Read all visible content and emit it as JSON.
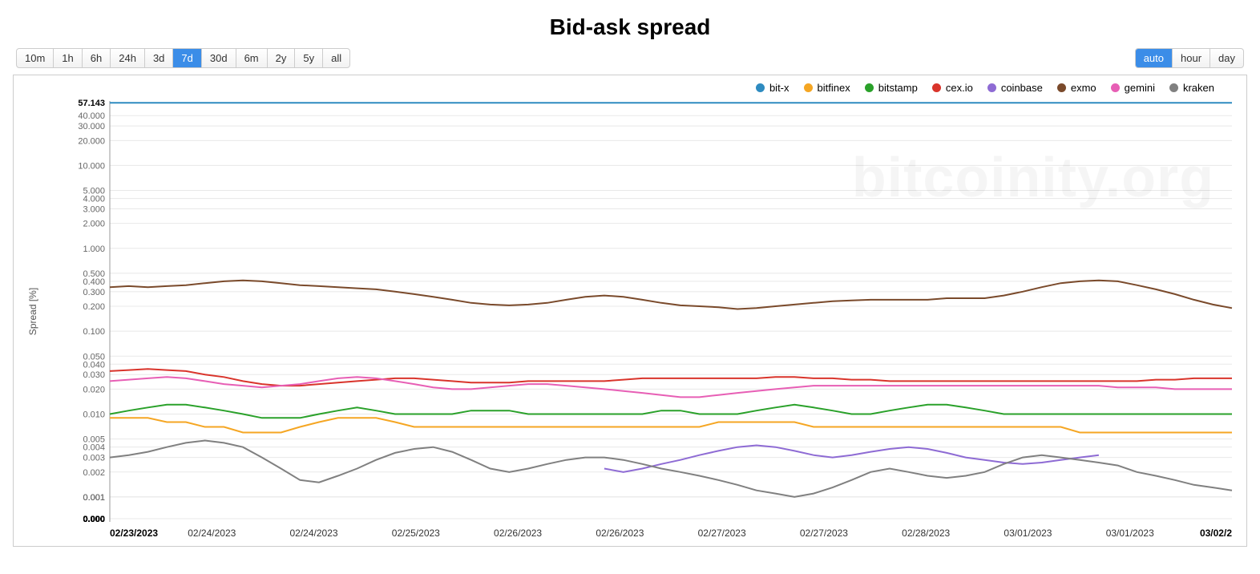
{
  "title": "Bid-ask spread",
  "watermark": "bitcoinity.org",
  "range_buttons": [
    "10m",
    "1h",
    "6h",
    "24h",
    "3d",
    "7d",
    "30d",
    "6m",
    "2y",
    "5y",
    "all"
  ],
  "range_active": "7d",
  "agg_buttons": [
    "auto",
    "hour",
    "day"
  ],
  "agg_active": "auto",
  "ylabel": "Spread [%]",
  "legend": [
    {
      "name": "bit-x",
      "color": "#2e8bc0"
    },
    {
      "name": "bitfinex",
      "color": "#f5a623"
    },
    {
      "name": "bitstamp",
      "color": "#2aa12a"
    },
    {
      "name": "cex.io",
      "color": "#d9342b"
    },
    {
      "name": "coinbase",
      "color": "#8e6bd4"
    },
    {
      "name": "exmo",
      "color": "#7a4a2b"
    },
    {
      "name": "gemini",
      "color": "#e75fb5"
    },
    {
      "name": "kraken",
      "color": "#808080"
    }
  ],
  "chart_data": {
    "type": "line",
    "title": "Bid-ask spread",
    "xlabel": "",
    "ylabel": "Spread [%]",
    "yscale": "log",
    "ylim": [
      0.0,
      57.143
    ],
    "yticks_top": 57.143,
    "yticks_bottom": 0.0,
    "yticks": [
      57.143,
      40.0,
      30.0,
      20.0,
      10.0,
      5.0,
      4.0,
      3.0,
      2.0,
      1.0,
      0.5,
      0.4,
      0.3,
      0.2,
      0.1,
      0.05,
      0.04,
      0.03,
      0.02,
      0.01,
      0.005,
      0.004,
      0.003,
      0.002,
      0.001,
      0.001,
      0.001,
      0.0,
      0.0,
      0.0,
      0.0,
      0.0,
      0.0,
      0.0,
      0.0
    ],
    "x": [
      "02/23/2023",
      "02/24/2023",
      "02/24/2023",
      "02/25/2023",
      "02/26/2023",
      "02/26/2023",
      "02/27/2023",
      "02/27/2023",
      "02/28/2023",
      "03/01/2023",
      "03/01/2023",
      "03/02/2"
    ],
    "x_bold_first": "02/23/2023",
    "x_bold_last": "03/02/2",
    "n_points": 60,
    "series": [
      {
        "name": "bit-x",
        "color": "#2e8bc0",
        "values": [
          57.143,
          57.143,
          57.143,
          57.143,
          57.143,
          57.143,
          57.143,
          57.143,
          57.143,
          57.143,
          57.143,
          57.143,
          57.143,
          57.143,
          57.143,
          57.143,
          57.143,
          57.143,
          57.143,
          57.143,
          57.143,
          57.143,
          57.143,
          57.143,
          57.143,
          57.143,
          57.143,
          57.143,
          57.143,
          57.143,
          57.143,
          57.143,
          57.143,
          57.143,
          57.143,
          57.143,
          57.143,
          57.143,
          57.143,
          57.143,
          57.143,
          57.143,
          57.143,
          57.143,
          57.143,
          57.143,
          57.143,
          57.143,
          57.143,
          57.143,
          57.143,
          57.143,
          57.143,
          57.143,
          57.143,
          57.143,
          57.143,
          57.143,
          57.143,
          57.143
        ]
      },
      {
        "name": "exmo",
        "color": "#7a4a2b",
        "values": [
          0.34,
          0.35,
          0.34,
          0.35,
          0.36,
          0.38,
          0.4,
          0.41,
          0.4,
          0.38,
          0.36,
          0.35,
          0.34,
          0.33,
          0.32,
          0.3,
          0.28,
          0.26,
          0.24,
          0.22,
          0.21,
          0.205,
          0.21,
          0.22,
          0.24,
          0.26,
          0.27,
          0.26,
          0.24,
          0.22,
          0.205,
          0.2,
          0.195,
          0.185,
          0.19,
          0.2,
          0.21,
          0.22,
          0.23,
          0.235,
          0.24,
          0.24,
          0.24,
          0.24,
          0.25,
          0.25,
          0.25,
          0.27,
          0.3,
          0.34,
          0.38,
          0.4,
          0.41,
          0.4,
          0.36,
          0.32,
          0.28,
          0.24,
          0.21,
          0.19
        ]
      },
      {
        "name": "cex.io",
        "color": "#d9342b",
        "values": [
          0.033,
          0.034,
          0.035,
          0.034,
          0.033,
          0.03,
          0.028,
          0.025,
          0.023,
          0.022,
          0.022,
          0.023,
          0.024,
          0.025,
          0.026,
          0.027,
          0.027,
          0.026,
          0.025,
          0.024,
          0.024,
          0.024,
          0.025,
          0.025,
          0.025,
          0.025,
          0.025,
          0.026,
          0.027,
          0.027,
          0.027,
          0.027,
          0.027,
          0.027,
          0.027,
          0.028,
          0.028,
          0.027,
          0.027,
          0.026,
          0.026,
          0.025,
          0.025,
          0.025,
          0.025,
          0.025,
          0.025,
          0.025,
          0.025,
          0.025,
          0.025,
          0.025,
          0.025,
          0.025,
          0.025,
          0.026,
          0.026,
          0.027,
          0.027,
          0.027
        ]
      },
      {
        "name": "gemini",
        "color": "#e75fb5",
        "values": [
          0.025,
          0.026,
          0.027,
          0.028,
          0.027,
          0.025,
          0.023,
          0.022,
          0.021,
          0.022,
          0.023,
          0.025,
          0.027,
          0.028,
          0.027,
          0.025,
          0.023,
          0.021,
          0.02,
          0.02,
          0.021,
          0.022,
          0.023,
          0.023,
          0.022,
          0.021,
          0.02,
          0.019,
          0.018,
          0.017,
          0.016,
          0.016,
          0.017,
          0.018,
          0.019,
          0.02,
          0.021,
          0.022,
          0.022,
          0.022,
          0.022,
          0.022,
          0.022,
          0.022,
          0.022,
          0.022,
          0.022,
          0.022,
          0.022,
          0.022,
          0.022,
          0.022,
          0.022,
          0.021,
          0.021,
          0.021,
          0.02,
          0.02,
          0.02,
          0.02
        ]
      },
      {
        "name": "bitstamp",
        "color": "#2aa12a",
        "values": [
          0.01,
          0.011,
          0.012,
          0.013,
          0.013,
          0.012,
          0.011,
          0.01,
          0.009,
          0.009,
          0.009,
          0.01,
          0.011,
          0.012,
          0.011,
          0.01,
          0.01,
          0.01,
          0.01,
          0.011,
          0.011,
          0.011,
          0.01,
          0.01,
          0.01,
          0.01,
          0.01,
          0.01,
          0.01,
          0.011,
          0.011,
          0.01,
          0.01,
          0.01,
          0.011,
          0.012,
          0.013,
          0.012,
          0.011,
          0.01,
          0.01,
          0.011,
          0.012,
          0.013,
          0.013,
          0.012,
          0.011,
          0.01,
          0.01,
          0.01,
          0.01,
          0.01,
          0.01,
          0.01,
          0.01,
          0.01,
          0.01,
          0.01,
          0.01,
          0.01
        ]
      },
      {
        "name": "bitfinex",
        "color": "#f5a623",
        "values": [
          0.009,
          0.009,
          0.009,
          0.008,
          0.008,
          0.007,
          0.007,
          0.006,
          0.006,
          0.006,
          0.007,
          0.008,
          0.009,
          0.009,
          0.009,
          0.008,
          0.007,
          0.007,
          0.007,
          0.007,
          0.007,
          0.007,
          0.007,
          0.007,
          0.007,
          0.007,
          0.007,
          0.007,
          0.007,
          0.007,
          0.007,
          0.007,
          0.008,
          0.008,
          0.008,
          0.008,
          0.008,
          0.007,
          0.007,
          0.007,
          0.007,
          0.007,
          0.007,
          0.007,
          0.007,
          0.007,
          0.007,
          0.007,
          0.007,
          0.007,
          0.007,
          0.006,
          0.006,
          0.006,
          0.006,
          0.006,
          0.006,
          0.006,
          0.006,
          0.006
        ]
      },
      {
        "name": "coinbase",
        "color": "#8e6bd4",
        "values": [
          null,
          null,
          null,
          null,
          null,
          null,
          null,
          null,
          null,
          null,
          null,
          null,
          null,
          null,
          null,
          null,
          null,
          null,
          null,
          null,
          null,
          null,
          null,
          null,
          null,
          null,
          0.0022,
          0.002,
          0.0022,
          0.0025,
          0.0028,
          0.0032,
          0.0036,
          0.004,
          0.0042,
          0.004,
          0.0036,
          0.0032,
          0.003,
          0.0032,
          0.0035,
          0.0038,
          0.004,
          0.0038,
          0.0034,
          0.003,
          0.0028,
          0.0026,
          0.0025,
          0.0026,
          0.0028,
          0.003,
          0.0032,
          null,
          null,
          null,
          null,
          null,
          null,
          null
        ]
      },
      {
        "name": "kraken",
        "color": "#808080",
        "values": [
          0.003,
          0.0032,
          0.0035,
          0.004,
          0.0045,
          0.0048,
          0.0045,
          0.004,
          0.003,
          0.0022,
          0.0016,
          0.0015,
          0.0018,
          0.0022,
          0.0028,
          0.0034,
          0.0038,
          0.004,
          0.0035,
          0.0028,
          0.0022,
          0.002,
          0.0022,
          0.0025,
          0.0028,
          0.003,
          0.003,
          0.0028,
          0.0025,
          0.0022,
          0.002,
          0.0018,
          0.0016,
          0.0014,
          0.0012,
          0.0011,
          0.001,
          0.0011,
          0.0013,
          0.0016,
          0.002,
          0.0022,
          0.002,
          0.0018,
          0.0017,
          0.0018,
          0.002,
          0.0025,
          0.003,
          0.0032,
          0.003,
          0.0028,
          0.0026,
          0.0024,
          0.002,
          0.0018,
          0.0016,
          0.0014,
          0.0013,
          0.0012
        ]
      }
    ]
  }
}
